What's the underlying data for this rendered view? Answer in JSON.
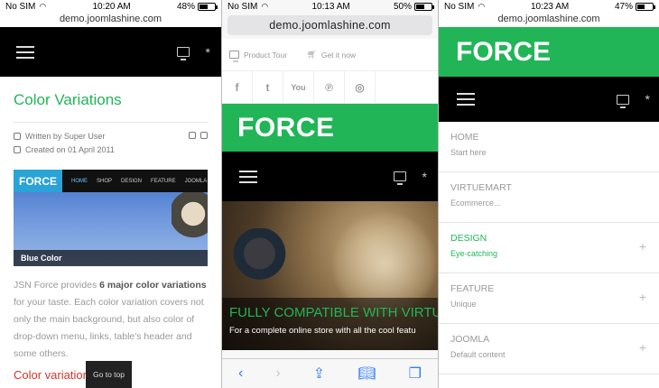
{
  "colors": {
    "accent_green": "#22b558",
    "black": "#000000",
    "ios_blue": "#2f7cf6",
    "heading_red": "#d6342a"
  },
  "left": {
    "status": {
      "carrier": "No SIM",
      "time": "10:20 AM",
      "battery": "48%",
      "battery_level": 0.48
    },
    "url": "demo.joomlashine.com",
    "article_title": "Color Variations",
    "author": "Written by Super User",
    "created": "Created on 01 April 2011",
    "preview": {
      "logo": "FORCE",
      "nav": [
        "HOME",
        "SHOP",
        "DESIGN",
        "FEATURE",
        "JOOMLA"
      ],
      "caption": "Blue Color"
    },
    "body_pre": "JSN Force provides ",
    "body_bold": "6 major color variations",
    "body_post": " for your taste. Each color variation covers not only the main background, but also color of drop-down menu, links, table's header and some others.",
    "subheading": "Color variations",
    "go_to_top": "Go to top"
  },
  "middle": {
    "status": {
      "carrier": "No SIM",
      "time": "10:13 AM",
      "battery": "50%",
      "battery_level": 0.5
    },
    "url": "demo.joomlashine.com",
    "links": [
      {
        "label": "Product Tour",
        "icon": "monitor-icon"
      },
      {
        "label": "Get it now",
        "icon": "cart-icon"
      }
    ],
    "socials": [
      "f",
      "t",
      "yt",
      "p",
      "dr"
    ],
    "brand": "FORCE",
    "hero_headline": "FULLY COMPATIBLE WITH VIRTUEMART",
    "hero_sub": "For a complete online store with all the cool featu"
  },
  "right": {
    "status": {
      "carrier": "No SIM",
      "time": "10:23 AM",
      "battery": "47%",
      "battery_level": 0.47
    },
    "url": "demo.joomlashine.com",
    "brand": "FORCE",
    "menu": [
      {
        "title": "HOME",
        "sub": "Start here"
      },
      {
        "title": "VIRTUEMART",
        "sub": "Ecommerce..."
      },
      {
        "title": "DESIGN",
        "sub": "Eye-catching"
      },
      {
        "title": "FEATURE",
        "sub": "Unique"
      },
      {
        "title": "JOOMLA",
        "sub": "Default content"
      }
    ]
  }
}
